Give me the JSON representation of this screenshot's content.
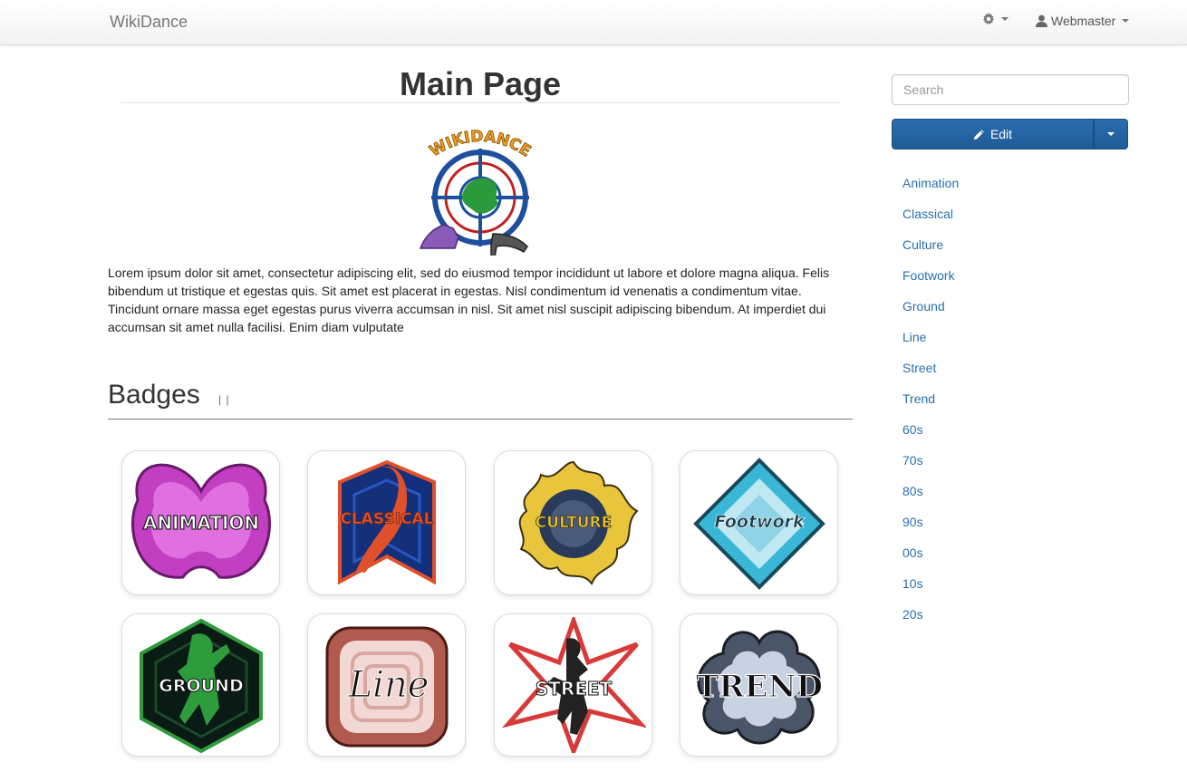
{
  "navbar": {
    "brand": "WikiDance",
    "user": "Webmaster",
    "icons": {
      "settings": "gear-icon",
      "user": "user-icon"
    }
  },
  "main": {
    "title": "Main Page",
    "logo_text": "WIKIDANCE",
    "intro": "Lorem ipsum dolor sit amet, consectetur adipiscing elit, sed do eiusmod tempor incididunt ut labore et dolore magna aliqua. Felis bibendum ut tristique et egestas quis. Sit amet est placerat in egestas. Nisl condimentum id venenatis a condimentum vitae. Tincidunt ornare massa eget egestas purus viverra accumsan in nisl. Sit amet nisl suscipit adipiscing bibendum. At imperdiet dui accumsan sit amet nulla facilisi. Enim diam vulputate",
    "badges_heading": "Badges",
    "badges_edit_marker": "| |",
    "badges": [
      {
        "label": "ANIMATION",
        "color": "#c23fc2"
      },
      {
        "label": "CLASSICAL",
        "color": "#e0512b"
      },
      {
        "label": "CULTURE",
        "color": "#e8c53a"
      },
      {
        "label": "Footwork",
        "color": "#3ab6d6"
      },
      {
        "label": "GROUND",
        "color": "#2e9c3c"
      },
      {
        "label": "Line",
        "color": "#b05a50"
      },
      {
        "label": "STREET",
        "color": "#d83a3a"
      },
      {
        "label": "TREND",
        "color": "#4a5668"
      }
    ]
  },
  "sidebar": {
    "search_placeholder": "Search",
    "edit_label": "Edit",
    "icons": {
      "edit": "pencil-icon",
      "dropdown": "caret-down-icon"
    },
    "categories": [
      "Animation",
      "Classical",
      "Culture",
      "Footwork",
      "Ground",
      "Line",
      "Street",
      "Trend",
      "60s",
      "70s",
      "80s",
      "90s",
      "00s",
      "10s",
      "20s"
    ]
  },
  "colors": {
    "link": "#2a6fb0",
    "primary_button": "#2568a6"
  }
}
